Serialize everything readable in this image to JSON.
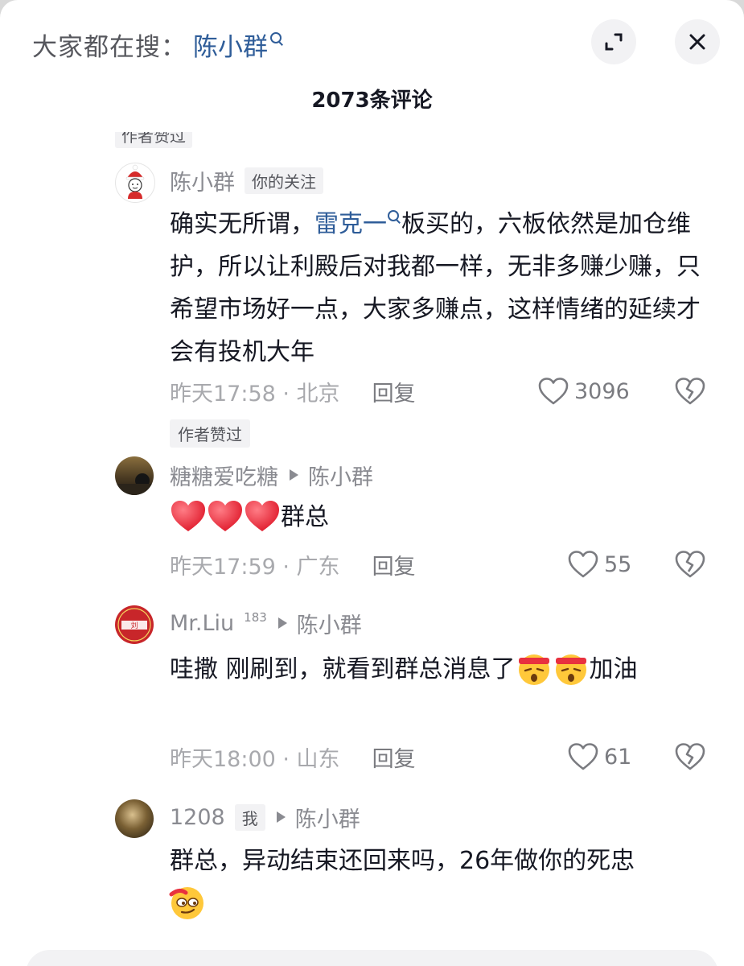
{
  "header": {
    "search_prefix": "大家都在搜：",
    "search_term": "陈小群",
    "title": "2073条评论",
    "top_clipped_tag": "作者赞过"
  },
  "comments": [
    {
      "author": "陈小群",
      "tag": "你的关注",
      "text_before_link": "确实无所谓，",
      "link_text": "雷克一",
      "text_after_link": "板买的，六板依然是加仓维护，所以让利殿后对我都一样，无非多赚少赚，只希望市场好一点，大家多赚点，这样情绪的延续才会有投机大年",
      "time_location": "昨天17:58 · 北京",
      "reply": "回复",
      "likes": "3096"
    },
    {
      "liked_tag": "作者赞过",
      "author": "糖糖爱吃糖",
      "reply_to": "陈小群",
      "text": "群总",
      "time_location": "昨天17:59 · 广东",
      "reply": "回复",
      "likes": "55"
    },
    {
      "author": "Mr.Liu",
      "badge": "183",
      "reply_to": "陈小群",
      "text_part1": "哇撒  刚刷到，就看到群总消息了",
      "text_part2": "加油",
      "time_location": "昨天18:00 · 山东",
      "reply": "回复",
      "likes": "61"
    },
    {
      "author": "1208",
      "tag": "我",
      "reply_to": "陈小群",
      "text": "群总，异动结束还回来吗，26年做你的死忠"
    }
  ],
  "icons": {
    "expand": "expand-icon",
    "close": "close-icon",
    "like": "heart-outline-icon",
    "dislike": "broken-heart-icon",
    "emoji_heart": "red-heart-emoji",
    "emoji_cheer": "headband-cheer-emoji",
    "emoji_smirk": "smirk-emoji"
  },
  "colors": {
    "link": "#2f5d99",
    "heart": "#e8313f"
  }
}
